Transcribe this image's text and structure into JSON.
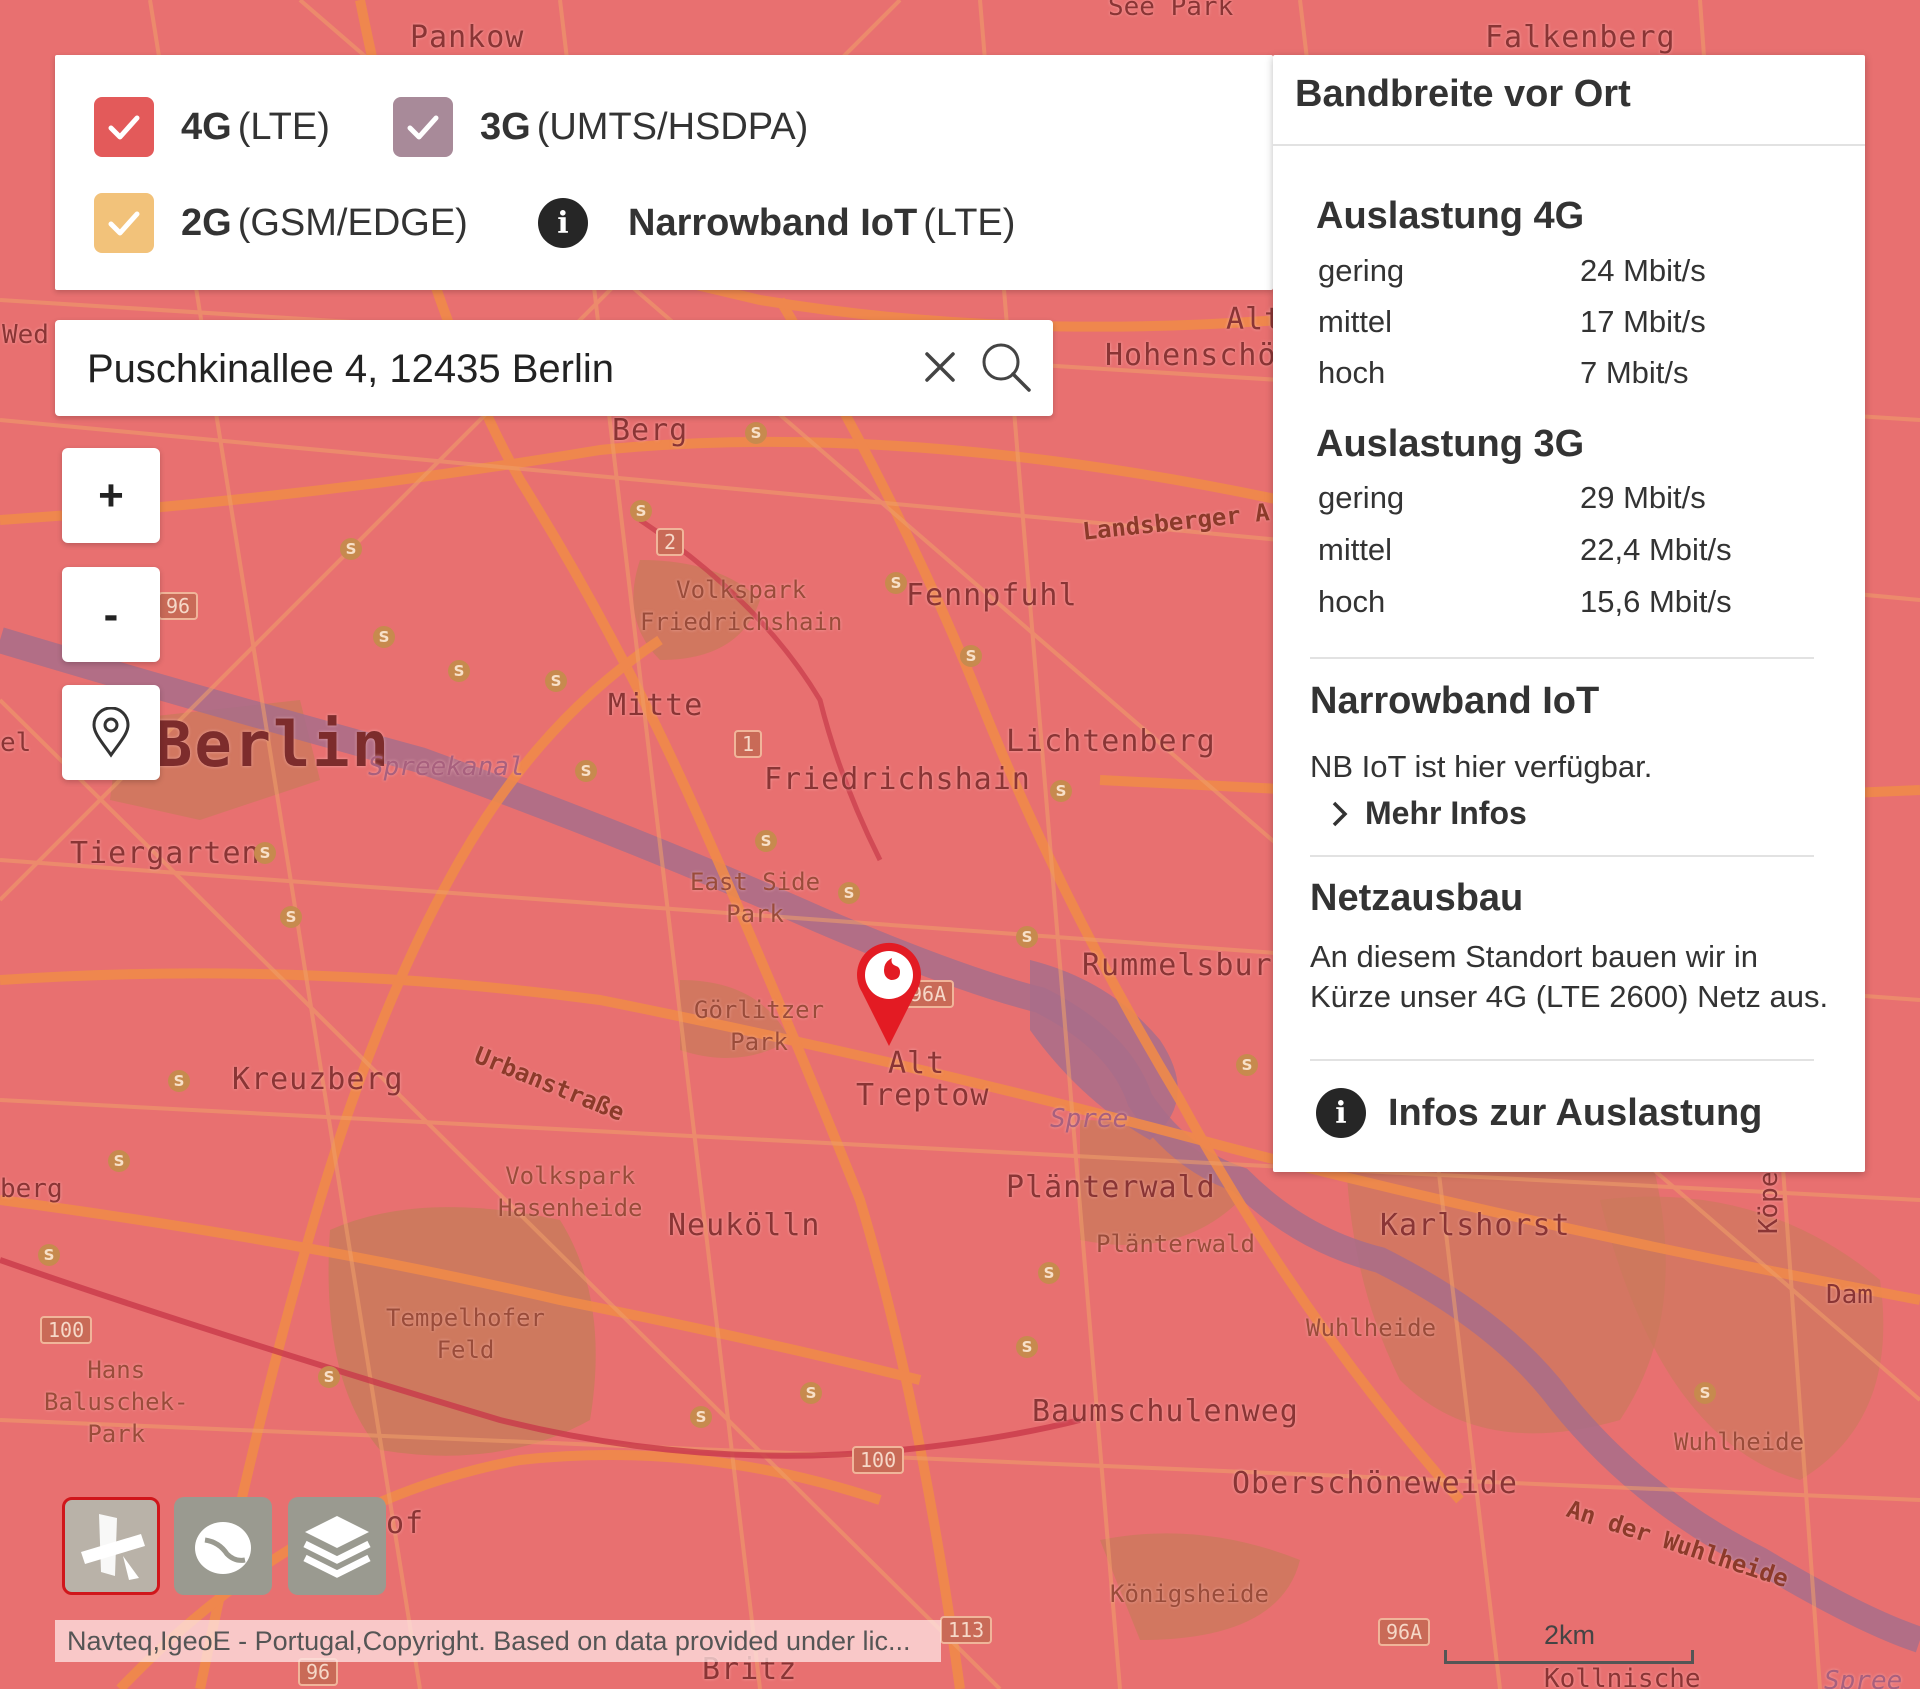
{
  "legend": {
    "items": [
      {
        "name": "4G",
        "suffix": "(LTE)",
        "color": "#e35a5a",
        "checked": true
      },
      {
        "name": "3G",
        "suffix": "(UMTS/HSDPA)",
        "color": "#a88a99",
        "checked": true
      },
      {
        "name": "2G",
        "suffix": "(GSM/EDGE)",
        "color": "#f2c27a",
        "checked": true
      }
    ],
    "nbiot": {
      "name": "Narrowband IoT",
      "suffix": "(LTE)",
      "info_icon": "info-icon"
    }
  },
  "search": {
    "value": "Puschkinallee 4, 12435 Berlin",
    "clear_icon": "close-icon",
    "search_icon": "search-icon"
  },
  "zoom": {
    "in_label": "+",
    "out_label": "-",
    "locate_icon": "map-pin-icon"
  },
  "panel": {
    "title": "Bandbreite vor Ort",
    "load4g": {
      "heading": "Auslastung 4G",
      "rows": [
        {
          "label": "gering",
          "value": "24 Mbit/s"
        },
        {
          "label": "mittel",
          "value": "17 Mbit/s"
        },
        {
          "label": "hoch",
          "value": "7 Mbit/s"
        }
      ]
    },
    "load3g": {
      "heading": "Auslastung 3G",
      "rows": [
        {
          "label": "gering",
          "value": "29 Mbit/s"
        },
        {
          "label": "mittel",
          "value": "22,4 Mbit/s"
        },
        {
          "label": "hoch",
          "value": "15,6 Mbit/s"
        }
      ]
    },
    "nbiot": {
      "heading": "Narrowband IoT",
      "text": "NB IoT ist hier verfügbar.",
      "more": "Mehr Infos"
    },
    "netzausbau": {
      "heading": "Netzausbau",
      "text1": "An diesem Standort bauen wir in",
      "text2": "Kürze unser 4G (LTE 2600) Netz aus."
    },
    "infos_link": "Infos zur Auslastung"
  },
  "map": {
    "labels": {
      "pankow": "Pankow",
      "seepark": "See Park",
      "falkenberg": "Falkenberg",
      "berg1": "Berg",
      "alt_hohen1": "Alt",
      "alt_hohen2": "Hohenschö",
      "landsberger": "Landsberger A",
      "volkspark_f1": "Volkspark",
      "volkspark_f2": "Friedrichshain",
      "fennpfuhl": "Fennpfuhl",
      "mitte": "Mitte",
      "berlin": "Berlin",
      "spreekanal": "Spreekanal",
      "lichtenberg": "Lichtenberg",
      "friedrichshain": "Friedrichshain",
      "tiergarten": "Tiergarten",
      "eastside1": "East Side",
      "eastside2": "Park",
      "rummelsburg": "Rummelsbur",
      "goerlitzer1": "Görlitzer",
      "goerlitzer2": "Park",
      "alt_treptow1": "Alt",
      "alt_treptow2": "Treptow",
      "kreuzberg": "Kreuzberg",
      "urbanstrasse": "Urbanstraße",
      "spree": "Spree",
      "volkspark_h1": "Volkspark",
      "volkspark_h2": "Hasenheide",
      "neukoelln": "Neukölln",
      "plaenterwald": "Plänterwald",
      "plaenterwald2": "Plänterwald",
      "karlshorst": "Karlshorst",
      "tempelhofer1": "Tempelhofer",
      "tempelhofer2": "Feld",
      "wuhlheide": "Wuhlheide",
      "wuhlheide2": "Wuhlheide",
      "hans1": "Hans",
      "hans2": "Baluschek-",
      "hans3": "Park",
      "baumschulenweg": "Baumschulenweg",
      "oberschoeneweide": "Oberschöneweide",
      "an_der_wuhlheide": "An der Wuhlheide",
      "koenigsheide": "Königsheide",
      "britz": "Britz",
      "dam": "Dam",
      "koepen": "Köpen",
      "el": "el",
      "berg_left": "berg",
      "wed": "Wed",
      "of": "of",
      "kollnische": "Kollnische",
      "spree2": "Spree"
    },
    "shields": [
      "96",
      "2",
      "1",
      "96A",
      "100",
      "100",
      "96A",
      "96",
      "113"
    ]
  },
  "layers": {
    "satellite_icon": "satellite-icon",
    "terrain_icon": "terrain-icon",
    "layers_icon": "layers-icon"
  },
  "attribution": "Navteq,IgeoE - Portugal,Copyright. Based on data provided under lic...",
  "scale": "2km",
  "colors": {
    "accent": "#d0161b",
    "coverage4g": "#e87070"
  }
}
